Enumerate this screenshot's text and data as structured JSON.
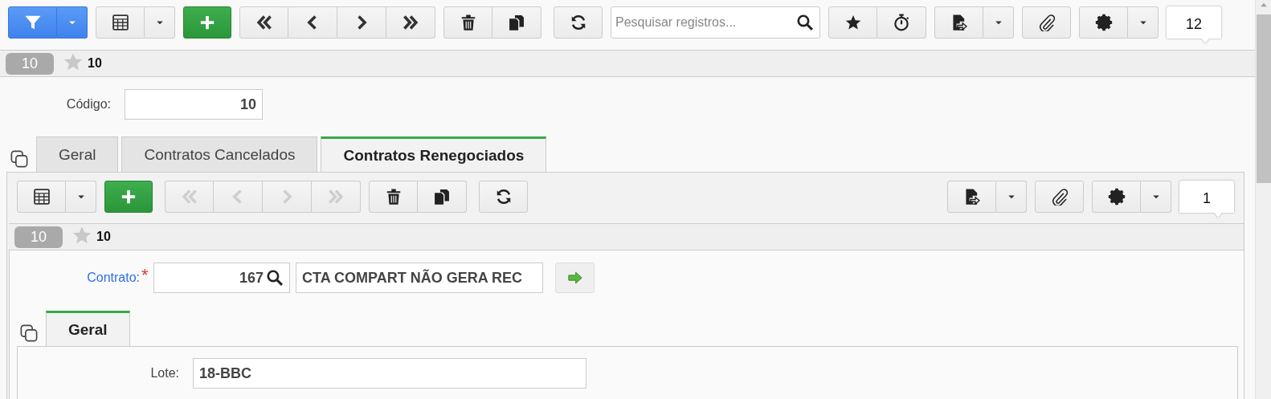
{
  "toolbar": {
    "navigation": [
      {
        "disabled": false
      },
      {
        "disabled": false
      },
      {
        "disabled": false
      },
      {
        "disabled": false
      }
    ],
    "search": {
      "placeholder": "Pesquisar registros..."
    },
    "record_count": "12"
  },
  "record": {
    "badge": "10",
    "starred": false,
    "title": "10"
  },
  "fields": [
    {
      "kind": "number",
      "label": "Código:",
      "value": "10"
    }
  ],
  "tabs": [
    {
      "label": "Geral",
      "selected": false
    },
    {
      "label": "Contratos Cancelados",
      "selected": false
    },
    {
      "label": "Contratos Renegociados",
      "selected": true
    }
  ],
  "detail": {
    "toolbar": {
      "navigation": [
        {
          "disabled": true
        },
        {
          "disabled": true
        },
        {
          "disabled": true
        },
        {
          "disabled": true
        }
      ],
      "record_count": "1"
    },
    "record": {
      "badge": "10",
      "starred": false,
      "title": "10"
    },
    "fields": [
      {
        "kind": "lookup",
        "label": "Contrato:",
        "required_mark": "*",
        "value": "167",
        "description": "CTA COMPART NÃO GERA REC"
      }
    ],
    "tabs": [
      {
        "label": "Geral",
        "selected": true
      }
    ],
    "tab_fields": [
      {
        "kind": "text",
        "label": "Lote:",
        "value": "18-BBC"
      }
    ]
  }
}
